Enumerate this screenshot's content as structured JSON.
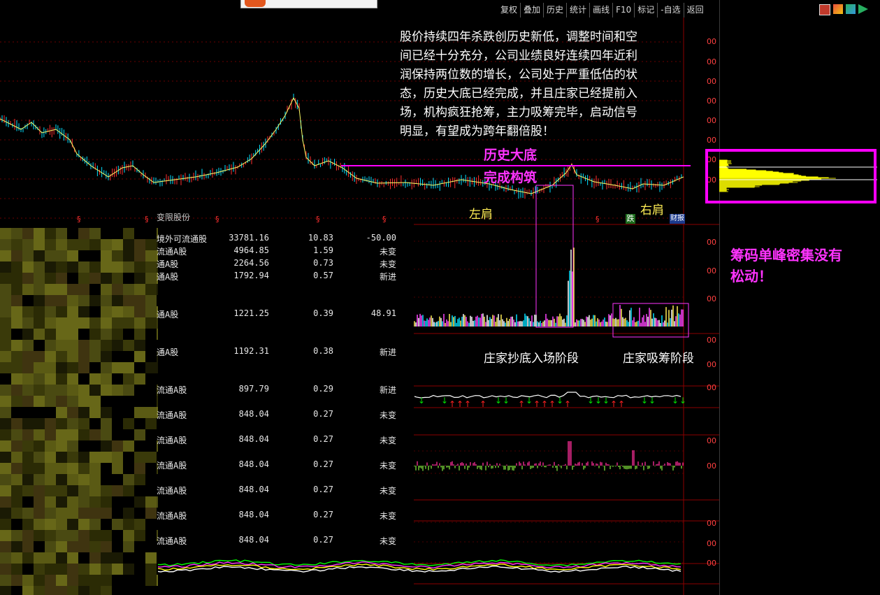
{
  "toolbar": {
    "items": [
      "复权",
      "叠加",
      "历史",
      "统计",
      "画线",
      "F10",
      "标记",
      "-自选",
      "返回"
    ]
  },
  "annotations": {
    "description": "股价持续四年杀跌创历史新低，调整时间和空间已经十分充分，公司业绩良好连续四年近利润保持两位数的增长，公司处于严重低估的状态，历史大底已经完成，并且庄家已经提前入场，机构疯狂抢筹，主力吸筹完毕，启动信号明显，有望成为跨年翻倍股！",
    "bottom_line1": "历史大底",
    "bottom_line2": "完成构筑",
    "left_shoulder": "左肩",
    "right_shoulder": "右肩",
    "stage1": "庄家抄底入场阶段",
    "stage2": "庄家吸筹阶段",
    "chip_note_line1": "筹码单峰密集没有",
    "chip_note_line2": "松动！"
  },
  "markers": {
    "fall": "跌",
    "finance": "财报"
  },
  "axis_labels": [
    "00",
    "00",
    "00",
    "00",
    "00",
    "00",
    "00",
    "00",
    "00",
    "00",
    "00",
    "00",
    "00",
    "00",
    "00",
    "00",
    "00",
    "00",
    "00",
    "00",
    "00"
  ],
  "shareholders": {
    "header_partial": "变限股份",
    "rows": [
      {
        "name": "境外可流通股",
        "shares": "33781.16",
        "pct": "10.83",
        "change": "-50.00"
      },
      {
        "name": "流通A股",
        "shares": "4964.85",
        "pct": "1.59",
        "change": "未变"
      },
      {
        "name": "通A股",
        "shares": "2264.56",
        "pct": "0.73",
        "change": "未变"
      },
      {
        "name": "通A股",
        "shares": "1792.94",
        "pct": "0.57",
        "change": "新进"
      },
      {
        "name": "通A股",
        "shares": "1221.25",
        "pct": "0.39",
        "change": "48.91"
      },
      {
        "name": "通A股",
        "shares": "1192.31",
        "pct": "0.38",
        "change": "新进"
      },
      {
        "name": "流通A股",
        "shares": "897.79",
        "pct": "0.29",
        "change": "新进"
      },
      {
        "name": "流通A股",
        "shares": "848.04",
        "pct": "0.27",
        "change": "未变"
      },
      {
        "name": "流通A股",
        "shares": "848.04",
        "pct": "0.27",
        "change": "未变"
      },
      {
        "name": "流通A股",
        "shares": "848.04",
        "pct": "0.27",
        "change": "未变"
      },
      {
        "name": "流通A股",
        "shares": "848.04",
        "pct": "0.27",
        "change": "未变"
      },
      {
        "name": "流通A股",
        "shares": "848.04",
        "pct": "0.27",
        "change": "未变"
      },
      {
        "name": "流通A股",
        "shares": "848.04",
        "pct": "0.27",
        "change": "未变"
      }
    ]
  },
  "colors": {
    "background": "#000000",
    "highlight": "#ff33ff",
    "rising": "#ff3030",
    "falling": "#00e0ff",
    "annotation_yellow": "#ffee55"
  }
}
